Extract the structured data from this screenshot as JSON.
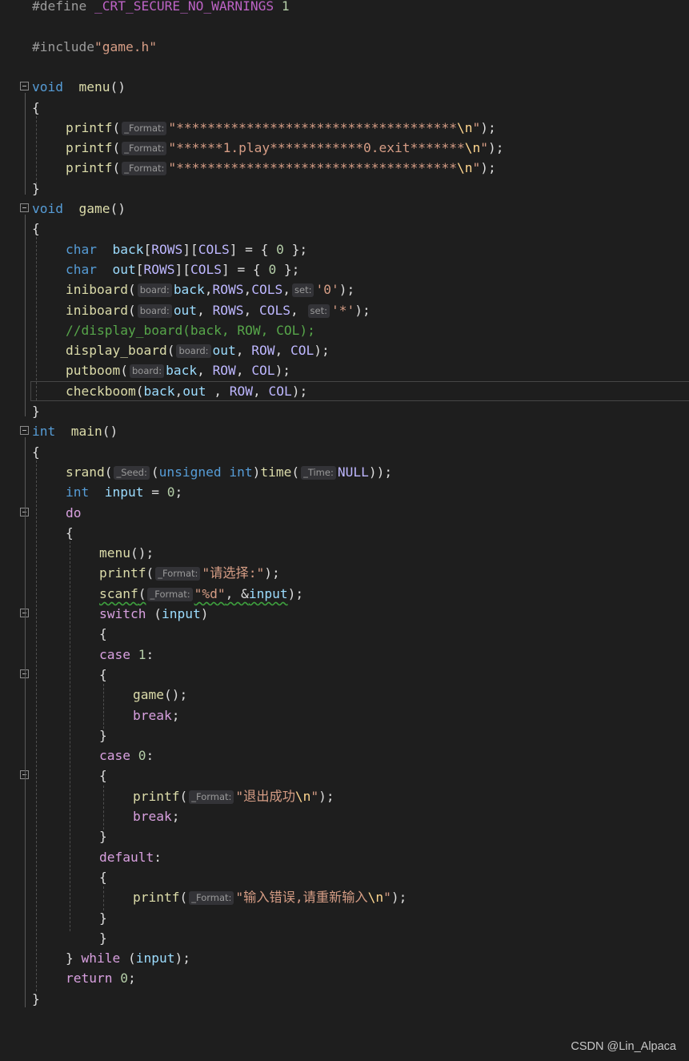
{
  "editor": {
    "lines": [
      {
        "fold": false,
        "indent": 0,
        "tokens": [
          [
            "pp",
            "#define "
          ],
          [
            "mac",
            "_CRT_SECURE_NO_WARNINGS"
          ],
          [
            "pp",
            " "
          ],
          [
            "num",
            "1"
          ]
        ]
      },
      {
        "fold": false,
        "indent": 0,
        "tokens": []
      },
      {
        "fold": false,
        "indent": 0,
        "tokens": [
          [
            "pp",
            "#include"
          ],
          [
            "str",
            "\"game.h\""
          ]
        ]
      },
      {
        "fold": false,
        "indent": 0,
        "tokens": []
      },
      {
        "fold": true,
        "indent": 0,
        "tokens": [
          [
            "kw",
            "void"
          ],
          [
            "",
            "  "
          ],
          [
            "fn",
            "menu"
          ],
          [
            "",
            "()"
          ]
        ]
      },
      {
        "fold": false,
        "indent": 0,
        "tokens": [
          [
            "",
            "{"
          ]
        ]
      },
      {
        "fold": false,
        "indent": 1,
        "tokens": [
          [
            "fn",
            "printf"
          ],
          [
            "",
            "("
          ],
          [
            "hint",
            "_Format:"
          ],
          [
            "str",
            "\"************************************"
          ],
          [
            "esc",
            "\\n"
          ],
          [
            "str",
            "\""
          ],
          [
            "",
            ");"
          ]
        ]
      },
      {
        "fold": false,
        "indent": 1,
        "tokens": [
          [
            "fn",
            "printf"
          ],
          [
            "",
            "("
          ],
          [
            "hint",
            "_Format:"
          ],
          [
            "str",
            "\"******1.play************0.exit*******"
          ],
          [
            "esc",
            "\\n"
          ],
          [
            "str",
            "\""
          ],
          [
            "",
            ");"
          ]
        ]
      },
      {
        "fold": false,
        "indent": 1,
        "tokens": [
          [
            "fn",
            "printf"
          ],
          [
            "",
            "("
          ],
          [
            "hint",
            "_Format:"
          ],
          [
            "str",
            "\"************************************"
          ],
          [
            "esc",
            "\\n"
          ],
          [
            "str",
            "\""
          ],
          [
            "",
            ");"
          ]
        ]
      },
      {
        "fold": false,
        "indent": 0,
        "tokens": [
          [
            "",
            "}"
          ]
        ]
      },
      {
        "fold": true,
        "indent": 0,
        "tokens": [
          [
            "kw",
            "void"
          ],
          [
            "",
            "  "
          ],
          [
            "fn",
            "game"
          ],
          [
            "",
            "()"
          ]
        ]
      },
      {
        "fold": false,
        "indent": 0,
        "tokens": [
          [
            "",
            "{"
          ]
        ]
      },
      {
        "fold": false,
        "indent": 1,
        "tokens": [
          [
            "kw",
            "char"
          ],
          [
            "",
            "  "
          ],
          [
            "var",
            "back"
          ],
          [
            "",
            "["
          ],
          [
            "macv",
            "ROWS"
          ],
          [
            "",
            "]["
          ],
          [
            "macv",
            "COLS"
          ],
          [
            "",
            "] = { "
          ],
          [
            "num",
            "0"
          ],
          [
            "",
            " };"
          ]
        ]
      },
      {
        "fold": false,
        "indent": 1,
        "tokens": [
          [
            "kw",
            "char"
          ],
          [
            "",
            "  "
          ],
          [
            "var",
            "out"
          ],
          [
            "",
            "["
          ],
          [
            "macv",
            "ROWS"
          ],
          [
            "",
            "]["
          ],
          [
            "macv",
            "COLS"
          ],
          [
            "",
            "] = { "
          ],
          [
            "num",
            "0"
          ],
          [
            "",
            " };"
          ]
        ]
      },
      {
        "fold": false,
        "indent": 1,
        "tokens": [
          [
            "fn",
            "iniboard"
          ],
          [
            "",
            "("
          ],
          [
            "hint",
            "board:"
          ],
          [
            "var",
            "back"
          ],
          [
            "",
            ","
          ],
          [
            "macv",
            "ROWS"
          ],
          [
            "",
            ","
          ],
          [
            "macv",
            "COLS"
          ],
          [
            "",
            ","
          ],
          [
            "hint",
            "set:"
          ],
          [
            "str",
            "'0'"
          ],
          [
            "",
            ");"
          ]
        ]
      },
      {
        "fold": false,
        "indent": 1,
        "tokens": [
          [
            "fn",
            "iniboard"
          ],
          [
            "",
            "("
          ],
          [
            "hint",
            "board:"
          ],
          [
            "var",
            "out"
          ],
          [
            "",
            ", "
          ],
          [
            "macv",
            "ROWS"
          ],
          [
            "",
            ", "
          ],
          [
            "macv",
            "COLS"
          ],
          [
            "",
            ", "
          ],
          [
            "hint",
            "set:"
          ],
          [
            "str",
            "'*'"
          ],
          [
            "",
            ");"
          ]
        ]
      },
      {
        "fold": false,
        "indent": 1,
        "tokens": [
          [
            "cmt",
            "//display_board(back, ROW, COL);"
          ]
        ]
      },
      {
        "fold": false,
        "indent": 1,
        "tokens": [
          [
            "fn",
            "display_board"
          ],
          [
            "",
            "("
          ],
          [
            "hint",
            "board:"
          ],
          [
            "var",
            "out"
          ],
          [
            "",
            ", "
          ],
          [
            "macv",
            "ROW"
          ],
          [
            "",
            ", "
          ],
          [
            "macv",
            "COL"
          ],
          [
            "",
            ");"
          ]
        ]
      },
      {
        "fold": false,
        "indent": 1,
        "tokens": [
          [
            "fn",
            "putboom"
          ],
          [
            "",
            "("
          ],
          [
            "hint",
            "board:"
          ],
          [
            "var",
            "back"
          ],
          [
            "",
            ", "
          ],
          [
            "macv",
            "ROW"
          ],
          [
            "",
            ", "
          ],
          [
            "macv",
            "COL"
          ],
          [
            "",
            ");"
          ]
        ]
      },
      {
        "fold": false,
        "indent": 1,
        "tokens": [
          [
            "fn",
            "checkboom"
          ],
          [
            "",
            "("
          ],
          [
            "var",
            "back"
          ],
          [
            "",
            ","
          ],
          [
            "var",
            "out"
          ],
          [
            "",
            " , "
          ],
          [
            "macv",
            "ROW"
          ],
          [
            "",
            ", "
          ],
          [
            "macv",
            "COL"
          ],
          [
            "",
            ");"
          ]
        ]
      },
      {
        "fold": false,
        "indent": 0,
        "tokens": [
          [
            "",
            "}"
          ]
        ]
      },
      {
        "fold": true,
        "indent": 0,
        "tokens": [
          [
            "kw",
            "int"
          ],
          [
            "",
            "  "
          ],
          [
            "fn",
            "main"
          ],
          [
            "",
            "()"
          ]
        ]
      },
      {
        "fold": false,
        "indent": 0,
        "tokens": [
          [
            "",
            "{"
          ]
        ]
      },
      {
        "fold": false,
        "indent": 1,
        "tokens": [
          [
            "fn",
            "srand"
          ],
          [
            "",
            "("
          ],
          [
            "hint",
            "_Seed:"
          ],
          [
            "",
            "("
          ],
          [
            "kw",
            "unsigned"
          ],
          [
            "",
            " "
          ],
          [
            "kw",
            "int"
          ],
          [
            "",
            ")"
          ],
          [
            "fn",
            "time"
          ],
          [
            "",
            "("
          ],
          [
            "hint",
            "_Time:"
          ],
          [
            "macv",
            "NULL"
          ],
          [
            "",
            "));"
          ]
        ]
      },
      {
        "fold": false,
        "indent": 1,
        "tokens": [
          [
            "kw",
            "int"
          ],
          [
            "",
            "  "
          ],
          [
            "var",
            "input"
          ],
          [
            "",
            " = "
          ],
          [
            "num",
            "0"
          ],
          [
            "",
            ";"
          ]
        ]
      },
      {
        "fold": true,
        "indent": 1,
        "tokens": [
          [
            "ctl",
            "do"
          ]
        ]
      },
      {
        "fold": false,
        "indent": 1,
        "tokens": [
          [
            "",
            "{"
          ]
        ]
      },
      {
        "fold": false,
        "indent": 2,
        "tokens": [
          [
            "fn",
            "menu"
          ],
          [
            "",
            "();"
          ]
        ]
      },
      {
        "fold": false,
        "indent": 2,
        "tokens": [
          [
            "fn",
            "printf"
          ],
          [
            "",
            "("
          ],
          [
            "hint",
            "_Format:"
          ],
          [
            "str",
            "\"请选择:\""
          ],
          [
            "",
            ");"
          ]
        ]
      },
      {
        "fold": false,
        "indent": 2,
        "tokens": [
          [
            "fn squig",
            "scanf"
          ],
          [
            "squig",
            "("
          ],
          [
            "hint",
            "_Format:"
          ],
          [
            "str squig",
            "\"%d\""
          ],
          [
            "squig",
            ", &"
          ],
          [
            "var squig",
            "input"
          ],
          [
            "",
            ");"
          ]
        ]
      },
      {
        "fold": true,
        "indent": 2,
        "tokens": [
          [
            "ctl",
            "switch"
          ],
          [
            "",
            " ("
          ],
          [
            "var",
            "input"
          ],
          [
            "",
            ")"
          ]
        ]
      },
      {
        "fold": false,
        "indent": 2,
        "tokens": [
          [
            "",
            "{"
          ]
        ]
      },
      {
        "fold": false,
        "indent": 2,
        "tokens": [
          [
            "ctl",
            "case"
          ],
          [
            "",
            " "
          ],
          [
            "num",
            "1"
          ],
          [
            "",
            ":"
          ]
        ]
      },
      {
        "fold": true,
        "indent": 2,
        "tokens": [
          [
            "",
            "{"
          ]
        ]
      },
      {
        "fold": false,
        "indent": 3,
        "tokens": [
          [
            "fn",
            "game"
          ],
          [
            "",
            "();"
          ]
        ]
      },
      {
        "fold": false,
        "indent": 3,
        "tokens": [
          [
            "ctl",
            "break"
          ],
          [
            "",
            ";"
          ]
        ]
      },
      {
        "fold": false,
        "indent": 2,
        "tokens": [
          [
            "",
            "}"
          ]
        ]
      },
      {
        "fold": false,
        "indent": 2,
        "tokens": [
          [
            "ctl",
            "case"
          ],
          [
            "",
            " "
          ],
          [
            "num",
            "0"
          ],
          [
            "",
            ":"
          ]
        ]
      },
      {
        "fold": true,
        "indent": 2,
        "tokens": [
          [
            "",
            "{"
          ]
        ]
      },
      {
        "fold": false,
        "indent": 3,
        "tokens": [
          [
            "fn",
            "printf"
          ],
          [
            "",
            "("
          ],
          [
            "hint",
            "_Format:"
          ],
          [
            "str",
            "\"退出成功"
          ],
          [
            "esc",
            "\\n"
          ],
          [
            "str",
            "\""
          ],
          [
            "",
            ");"
          ]
        ]
      },
      {
        "fold": false,
        "indent": 3,
        "tokens": [
          [
            "ctl",
            "break"
          ],
          [
            "",
            ";"
          ]
        ]
      },
      {
        "fold": false,
        "indent": 2,
        "tokens": [
          [
            "",
            "}"
          ]
        ]
      },
      {
        "fold": false,
        "indent": 2,
        "tokens": [
          [
            "ctl",
            "default"
          ],
          [
            "",
            ":"
          ]
        ]
      },
      {
        "fold": false,
        "indent": 2,
        "tokens": [
          [
            "",
            "{"
          ]
        ]
      },
      {
        "fold": false,
        "indent": 3,
        "tokens": [
          [
            "fn",
            "printf"
          ],
          [
            "",
            "("
          ],
          [
            "hint",
            "_Format:"
          ],
          [
            "str",
            "\"输入错误,请重新输入"
          ],
          [
            "esc",
            "\\n"
          ],
          [
            "str",
            "\""
          ],
          [
            "",
            ");"
          ]
        ]
      },
      {
        "fold": false,
        "indent": 2,
        "tokens": [
          [
            "",
            "}"
          ]
        ]
      },
      {
        "fold": false,
        "indent": 2,
        "tokens": [
          [
            "",
            "}"
          ]
        ]
      },
      {
        "fold": false,
        "indent": 1,
        "tokens": [
          [
            "",
            "} "
          ],
          [
            "ctl",
            "while"
          ],
          [
            "",
            " ("
          ],
          [
            "var",
            "input"
          ],
          [
            "",
            ");"
          ]
        ]
      },
      {
        "fold": false,
        "indent": 1,
        "tokens": [
          [
            "ctl",
            "return"
          ],
          [
            "",
            " "
          ],
          [
            "num",
            "0"
          ],
          [
            "",
            ";"
          ]
        ]
      },
      {
        "fold": false,
        "indent": 0,
        "tokens": [
          [
            "",
            "}"
          ]
        ]
      }
    ]
  },
  "watermark": "CSDN @Lin_Alpaca"
}
